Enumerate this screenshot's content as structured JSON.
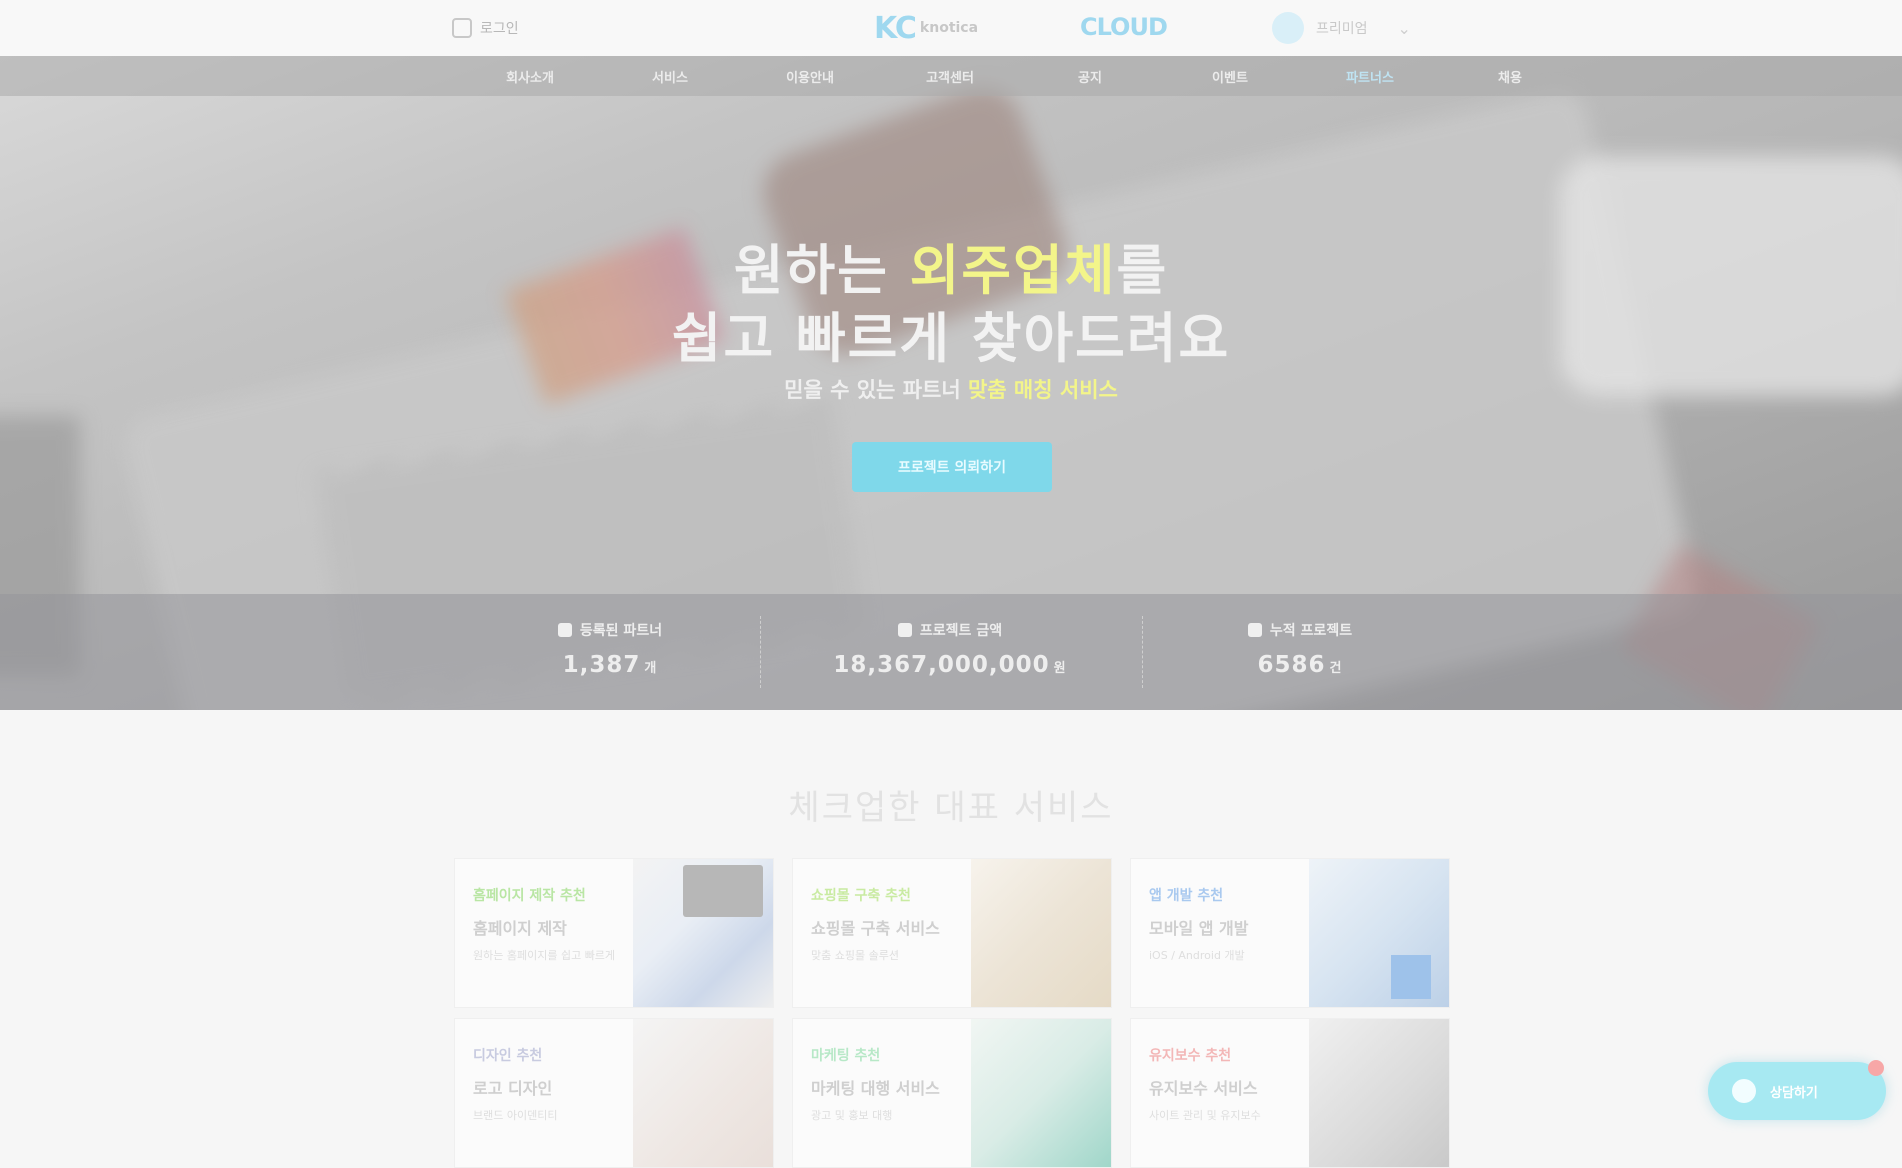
{
  "header": {
    "login_label": "로그인",
    "brand_mark": "KC",
    "brand_sub": "knotica",
    "partner_label": "CLOUD",
    "select_label": "프리미엄",
    "chevron": "⌄"
  },
  "nav": {
    "items": [
      "회사소개",
      "서비스",
      "이용안내",
      "고객센터",
      "공지",
      "이벤트",
      "파트너스",
      "채용"
    ],
    "active_index": 6
  },
  "hero": {
    "line1_a": "원하는 ",
    "line1_highlight": "외주업체",
    "line1_b": "를",
    "line2": "쉽고 빠르게 찾아드려요",
    "sub_a": "믿을 수 있는 파트너 ",
    "sub_highlight": "맞춤 매칭 서비스",
    "cta_label": "프로젝트 의뢰하기",
    "highlight_color": "#f3f58a",
    "accent_color": "#7fd8ea"
  },
  "stats": [
    {
      "label": "등록된 파트너",
      "value": "1,387",
      "unit": "개"
    },
    {
      "label": "프로젝트 금액",
      "value": "18,367,000,000",
      "unit": "원"
    },
    {
      "label": "누적 프로젝트",
      "value": "6586",
      "unit": "건"
    }
  ],
  "services": {
    "title": "체크업한 대표 서비스",
    "cards": [
      {
        "tag": "홈페이지 제작 추천",
        "tag_color": "#b9e6a4",
        "title": "홈페이지 제작",
        "desc": "원하는 홈페이지를 쉽고 빠르게"
      },
      {
        "tag": "쇼핑몰 구축 추천",
        "tag_color": "#c9eba2",
        "title": "쇼핑몰 구축 서비스",
        "desc": "맞춤 쇼핑몰 솔루션"
      },
      {
        "tag": "앱 개발 추천",
        "tag_color": "#a9c9ef",
        "title": "모바일 앱 개발",
        "desc": "iOS / Android 개발"
      },
      {
        "tag": "디자인 추천",
        "tag_color": "#c8cbe0",
        "title": "로고 디자인",
        "desc": "브랜드 아이덴티티"
      },
      {
        "tag": "마케팅 추천",
        "tag_color": "#b7e8c7",
        "title": "마케팅 대행 서비스",
        "desc": "광고 및 홍보 대행"
      },
      {
        "tag": "유지보수 추천",
        "tag_color": "#f3b7b7",
        "title": "유지보수 서비스",
        "desc": "사이트 관리 및 유지보수"
      }
    ]
  },
  "chat": {
    "label": "상담하기"
  }
}
